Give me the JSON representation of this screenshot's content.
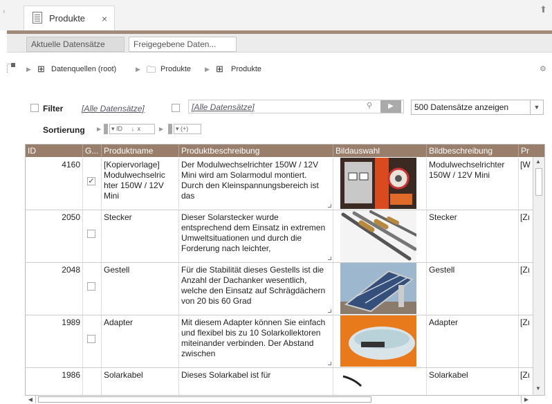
{
  "tab": {
    "label": "Produkte",
    "close": "×"
  },
  "subtabs": {
    "aktuell": "Aktuelle Datensätze",
    "freigegeben": "Freigegebene Daten..."
  },
  "breadcrumb": {
    "root": "Datenquellen (root)",
    "folder": "Produkte",
    "table": "Produkte"
  },
  "filter": {
    "label": "Filter",
    "all_link": "[Alle Datensätze]",
    "input_value": "[Alle Datensätze]",
    "records_option": "500 Datensätze anzeigen"
  },
  "sort": {
    "label": "Sortierung",
    "field": "ID",
    "direction": "↓",
    "remove": "x",
    "add": "(+)"
  },
  "grid": {
    "columns": [
      "ID",
      "G...",
      "Produktname",
      "Produktbeschreibung",
      "Bildauswahl",
      "Bildbeschreibung",
      "Pr"
    ],
    "rows": [
      {
        "id": "4160",
        "checked": true,
        "name": "[Kopiervorlage] Modulwechselric hter 150W / 12V Mini",
        "desc": "Der Modulwechselrichter 150W / 12V Mini wird am Solarmodul montiert. Durch den Kleinspannungsbereich ist das",
        "image": "inverter-photo",
        "img_desc": "Modulwechselrichter 150W / 12V Mini",
        "pr": "[W"
      },
      {
        "id": "2050",
        "checked": false,
        "name": "Stecker",
        "desc": "Dieser Solarstecker wurde entsprechend dem Einsatz in extremen Umweltsituationen und durch die Forderung nach leichter,",
        "image": "connector-photo",
        "img_desc": "Stecker",
        "pr": "[Zı"
      },
      {
        "id": "2048",
        "checked": false,
        "name": "Gestell",
        "desc": "Für die Stabilität dieses Gestells ist die Anzahl der Dachanker wesentlich, welche den Einsatz auf Schrägdächern von 20 bis 60 Grad",
        "image": "solar-panel-photo",
        "img_desc": "Gestell",
        "pr": "[Zı"
      },
      {
        "id": "1989",
        "checked": false,
        "name": "Adapter",
        "desc": "Mit diesem Adapter können Sie einfach und flexibel bis zu 10 Solarkollektoren miteinander verbinden. Der Abstand zwischen",
        "image": "adapter-photo",
        "img_desc": "Adapter",
        "pr": "[Zı"
      },
      {
        "id": "1986",
        "checked": false,
        "name": "Solarkabel",
        "desc": "Dieses Solarkabel ist für",
        "image": "cable-photo",
        "img_desc": "Solarkabel",
        "pr": "[Zı"
      }
    ]
  },
  "colors": {
    "header": "#9a7e6c",
    "accent": "#a08b7b"
  }
}
